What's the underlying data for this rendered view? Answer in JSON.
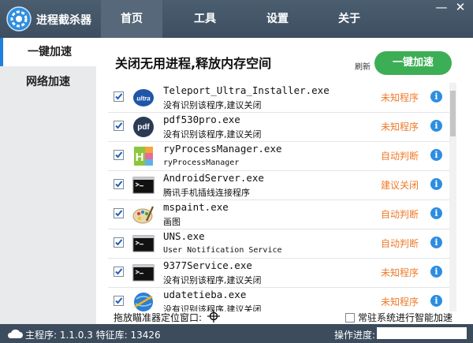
{
  "app": {
    "title": "进程截杀器"
  },
  "tabs": [
    {
      "label": "首页",
      "active": true
    },
    {
      "label": "工具",
      "active": false
    },
    {
      "label": "设置",
      "active": false
    },
    {
      "label": "关于",
      "active": false
    }
  ],
  "window_controls": {
    "minimize": "—",
    "close": "✕"
  },
  "sidebar": {
    "items": [
      {
        "label": "一键加速",
        "active": true
      },
      {
        "label": "网络加速",
        "active": false
      }
    ]
  },
  "main": {
    "heading": "关闭无用进程,释放内存空间",
    "refresh_label": "刷新",
    "accelerate_button": "一键加速",
    "processes": [
      {
        "name": "Teleport_Ultra_Installer.exe",
        "desc": "没有识别该程序,建议关闭",
        "status": "未知程序",
        "icon": "ultra-icon",
        "checked": true
      },
      {
        "name": "pdf530pro.exe",
        "desc": "没有识别该程序,建议关闭",
        "status": "未知程序",
        "icon": "pdf-icon",
        "checked": true
      },
      {
        "name": "ryProcessManager.exe",
        "desc": "ryProcessManager",
        "status": "自动判断",
        "icon": "h5-icon",
        "checked": true
      },
      {
        "name": "AndroidServer.exe",
        "desc": "腾讯手机插线连接程序",
        "status": "建议关闭",
        "icon": "console-icon",
        "checked": true
      },
      {
        "name": "mspaint.exe",
        "desc": "画图",
        "status": "自动判断",
        "icon": "palette-icon",
        "checked": true
      },
      {
        "name": "UNS.exe",
        "desc": "User Notification Service",
        "status": "自动判断",
        "icon": "console-icon",
        "checked": true
      },
      {
        "name": "9377Service.exe",
        "desc": "没有识别该程序,建议关闭",
        "status": "未知程序",
        "icon": "console-icon",
        "checked": true
      },
      {
        "name": "udatetieba.exe",
        "desc": "没有识别该程序,建议关闭",
        "status": "未知程序",
        "icon": "globe-icon",
        "checked": true
      }
    ],
    "info_glyph": "i",
    "target_window_label": "拖放瞄准器定位窗口:",
    "autostart_label": "常驻系统进行智能加速",
    "autostart_checked": false
  },
  "statusbar": {
    "version_text": "主程序: 1.1.0.3 特征库: 13426",
    "progress_label": "操作进度:",
    "progress": 0
  },
  "colors": {
    "accent": "#3cae55",
    "titlebar": "#3c4e60",
    "status_orange": "#ee7a2a",
    "info_blue": "#2d8de0"
  }
}
